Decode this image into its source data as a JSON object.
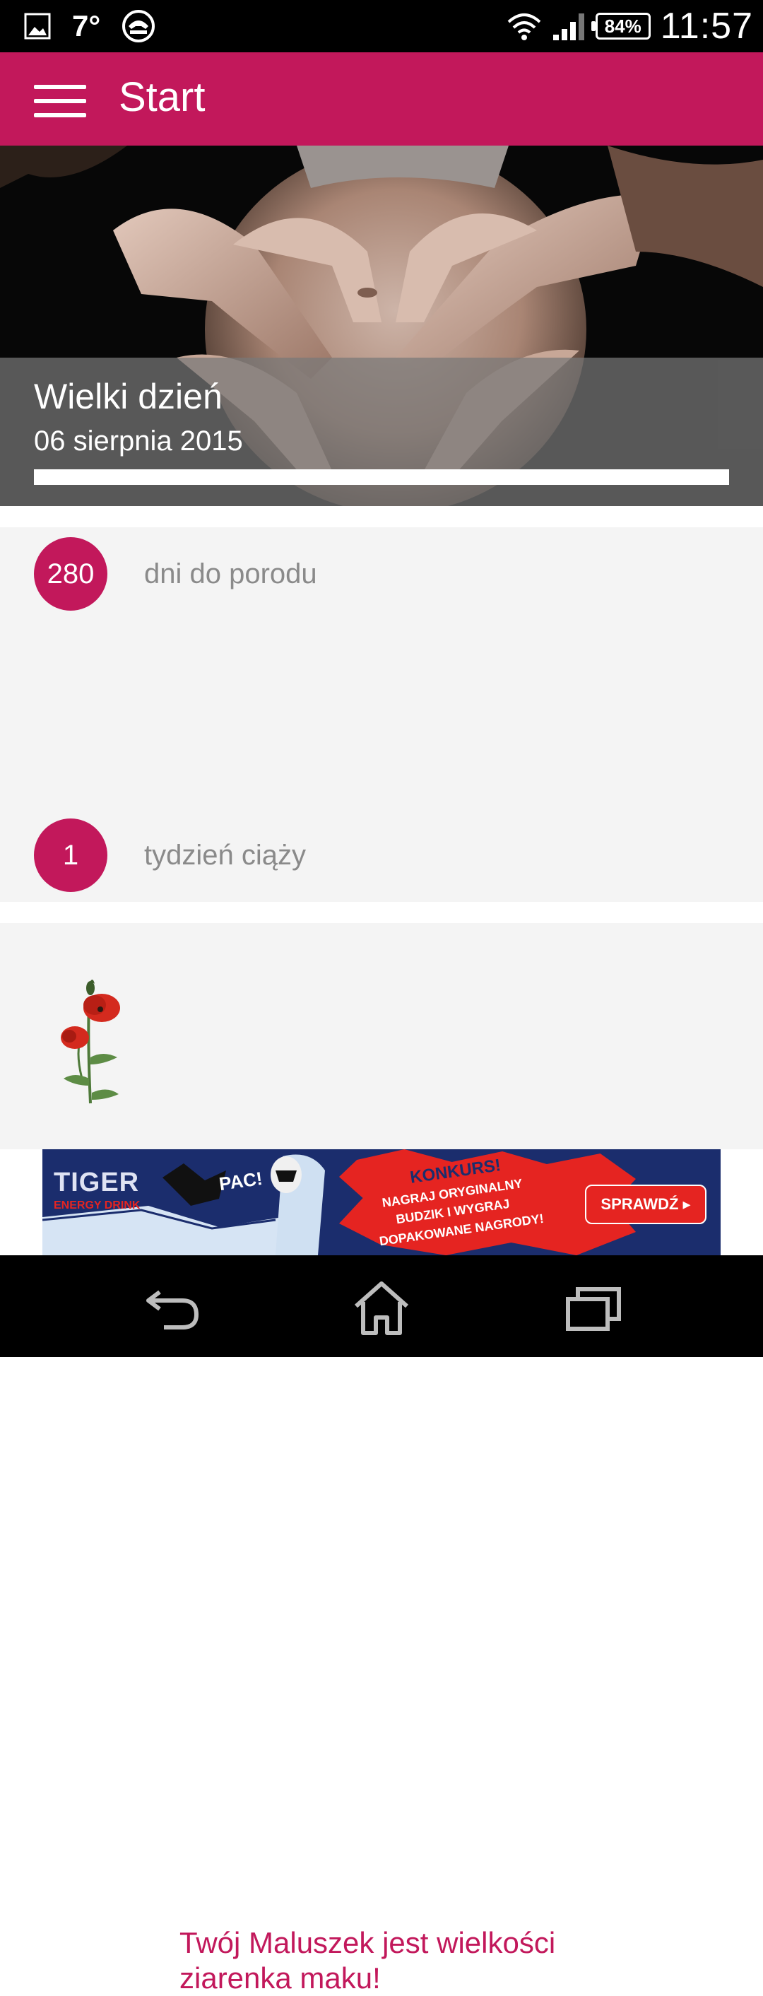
{
  "status_bar": {
    "temperature": "7°",
    "battery": "84%",
    "time": "11:57",
    "icons": [
      "image-icon",
      "weather-icon",
      "voicemail-icon",
      "wifi-icon",
      "signal-icon",
      "battery-icon"
    ]
  },
  "app_bar": {
    "title": "Start",
    "color": "#c2185b"
  },
  "hero": {
    "title": "Wielki dzień",
    "date": "06 sierpnia 2015",
    "progress_fraction": 0.0
  },
  "stats": {
    "days_value": "280",
    "days_label": "dni do porodu",
    "week_value": "1",
    "week_label": "tydzień ciąży"
  },
  "baby_size": {
    "text": "Twój Maluszek jest wielkości ziarenka maku!",
    "image": "poppy-flower"
  },
  "ad": {
    "brand": "TIGER",
    "brand_sub": "ENERGY DRINK",
    "bubble": "PAC!",
    "headline": "KONKURS!",
    "line1": "NAGRAJ ORYGINALNY",
    "line2": "BUDZIK I WYGRAJ",
    "line3": "DOPAKOWANE NAGRODY!",
    "button": "SPRAWDŹ ▸"
  },
  "nav_bar": {
    "icons": [
      "back-icon",
      "home-icon",
      "recent-apps-icon"
    ]
  }
}
